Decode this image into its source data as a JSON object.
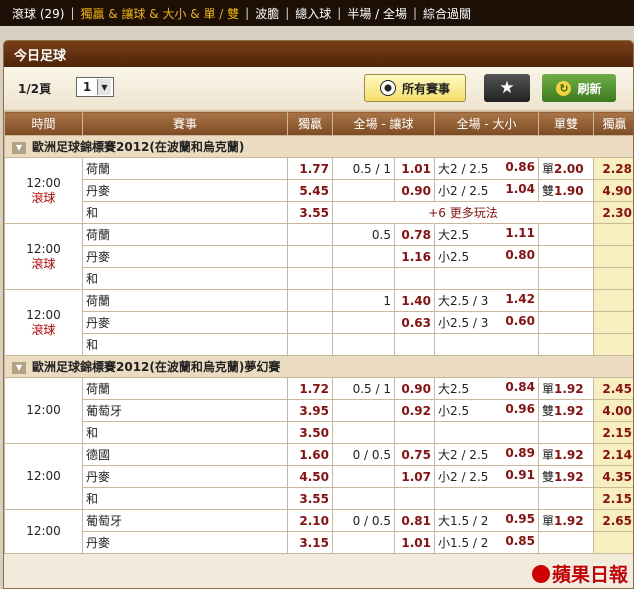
{
  "nav": {
    "items": [
      {
        "label": "滾球 (29)",
        "active": false
      },
      {
        "label": "獨贏 & 讓球 & 大小 & 單 / 雙",
        "active": true
      },
      {
        "label": "波膽",
        "active": false
      },
      {
        "label": "總入球",
        "active": false
      },
      {
        "label": "半場 / 全場",
        "active": false
      },
      {
        "label": "綜合過關",
        "active": false
      }
    ]
  },
  "panel": {
    "title": "今日足球"
  },
  "toolbar": {
    "page_label": "1/2頁",
    "page_value": "1",
    "all_events_label": "所有賽事",
    "refresh_label": "刷新"
  },
  "table": {
    "headers": [
      "時間",
      "賽事",
      "獨贏",
      "全場 - 讓球",
      "全場 - 大小",
      "單雙",
      "獨贏"
    ],
    "groups": [
      {
        "league": "歐洲足球錦標賽2012(在波蘭和烏克蘭)",
        "matches": [
          {
            "time": "12:00",
            "live": "滾球",
            "rows": [
              {
                "team": "荷蘭",
                "ml": "1.77",
                "hl": "0.5 / 1",
                "ho": "1.01",
                "oul": "大2 / 2.5",
                "ouo": "0.86",
                "oel": "單",
                "oeo": "2.00",
                "last": "2.28"
              },
              {
                "team": "丹麥",
                "ml": "5.45",
                "hl": "",
                "ho": "0.90",
                "oul": "小2 / 2.5",
                "ouo": "1.04",
                "oel": "雙",
                "oeo": "1.90",
                "last": "4.90"
              },
              {
                "team": "和",
                "ml": "3.55",
                "more": "+6 更多玩法",
                "last": "2.30"
              }
            ]
          },
          {
            "time": "12:00",
            "live": "滾球",
            "rows": [
              {
                "team": "荷蘭",
                "ml": "",
                "hl": "0.5",
                "ho": "0.78",
                "oul": "大2.5",
                "ouo": "1.11",
                "oel": "",
                "oeo": "",
                "last": ""
              },
              {
                "team": "丹麥",
                "ml": "",
                "hl": "",
                "ho": "1.16",
                "oul": "小2.5",
                "ouo": "0.80",
                "oel": "",
                "oeo": "",
                "last": ""
              },
              {
                "team": "和",
                "ml": "",
                "hl": "",
                "ho": "",
                "oul": "",
                "ouo": "",
                "oel": "",
                "oeo": "",
                "last": ""
              }
            ]
          },
          {
            "time": "12:00",
            "live": "滾球",
            "rows": [
              {
                "team": "荷蘭",
                "ml": "",
                "hl": "1",
                "ho": "1.40",
                "oul": "大2.5 / 3",
                "ouo": "1.42",
                "oel": "",
                "oeo": "",
                "last": ""
              },
              {
                "team": "丹麥",
                "ml": "",
                "hl": "",
                "ho": "0.63",
                "oul": "小2.5 / 3",
                "ouo": "0.60",
                "oel": "",
                "oeo": "",
                "last": ""
              },
              {
                "team": "和",
                "ml": "",
                "hl": "",
                "ho": "",
                "oul": "",
                "ouo": "",
                "oel": "",
                "oeo": "",
                "last": ""
              }
            ]
          }
        ]
      },
      {
        "league": "歐洲足球錦標賽2012(在波蘭和烏克蘭)夢幻賽",
        "matches": [
          {
            "time": "12:00",
            "live": "",
            "rows": [
              {
                "team": "荷蘭",
                "ml": "1.72",
                "hl": "0.5 / 1",
                "ho": "0.90",
                "oul": "大2.5",
                "ouo": "0.84",
                "oel": "單",
                "oeo": "1.92",
                "last": "2.45"
              },
              {
                "team": "葡萄牙",
                "ml": "3.95",
                "hl": "",
                "ho": "0.92",
                "oul": "小2.5",
                "ouo": "0.96",
                "oel": "雙",
                "oeo": "1.92",
                "last": "4.00"
              },
              {
                "team": "和",
                "ml": "3.50",
                "hl": "",
                "ho": "",
                "oul": "",
                "ouo": "",
                "oel": "",
                "oeo": "",
                "last": "2.15"
              }
            ]
          },
          {
            "time": "12:00",
            "live": "",
            "rows": [
              {
                "team": "德國",
                "ml": "1.60",
                "hl": "0 / 0.5",
                "ho": "0.75",
                "oul": "大2 / 2.5",
                "ouo": "0.89",
                "oel": "單",
                "oeo": "1.92",
                "last": "2.14"
              },
              {
                "team": "丹麥",
                "ml": "4.50",
                "hl": "",
                "ho": "1.07",
                "oul": "小2 / 2.5",
                "ouo": "0.91",
                "oel": "雙",
                "oeo": "1.92",
                "last": "4.35"
              },
              {
                "team": "和",
                "ml": "3.55",
                "hl": "",
                "ho": "",
                "oul": "",
                "ouo": "",
                "oel": "",
                "oeo": "",
                "last": "2.15"
              }
            ]
          },
          {
            "time": "12:00",
            "live": "",
            "rows": [
              {
                "team": "葡萄牙",
                "ml": "2.10",
                "hl": "0 / 0.5",
                "ho": "0.81",
                "oul": "大1.5 / 2",
                "ouo": "0.95",
                "oel": "單",
                "oeo": "1.92",
                "last": "2.65"
              },
              {
                "team": "丹麥",
                "ml": "3.15",
                "hl": "",
                "ho": "1.01",
                "oul": "小1.5 / 2",
                "ouo": "0.85",
                "oel": "",
                "oeo": "",
                "last": ""
              }
            ]
          }
        ]
      }
    ]
  },
  "watermark": "蘋果日報"
}
